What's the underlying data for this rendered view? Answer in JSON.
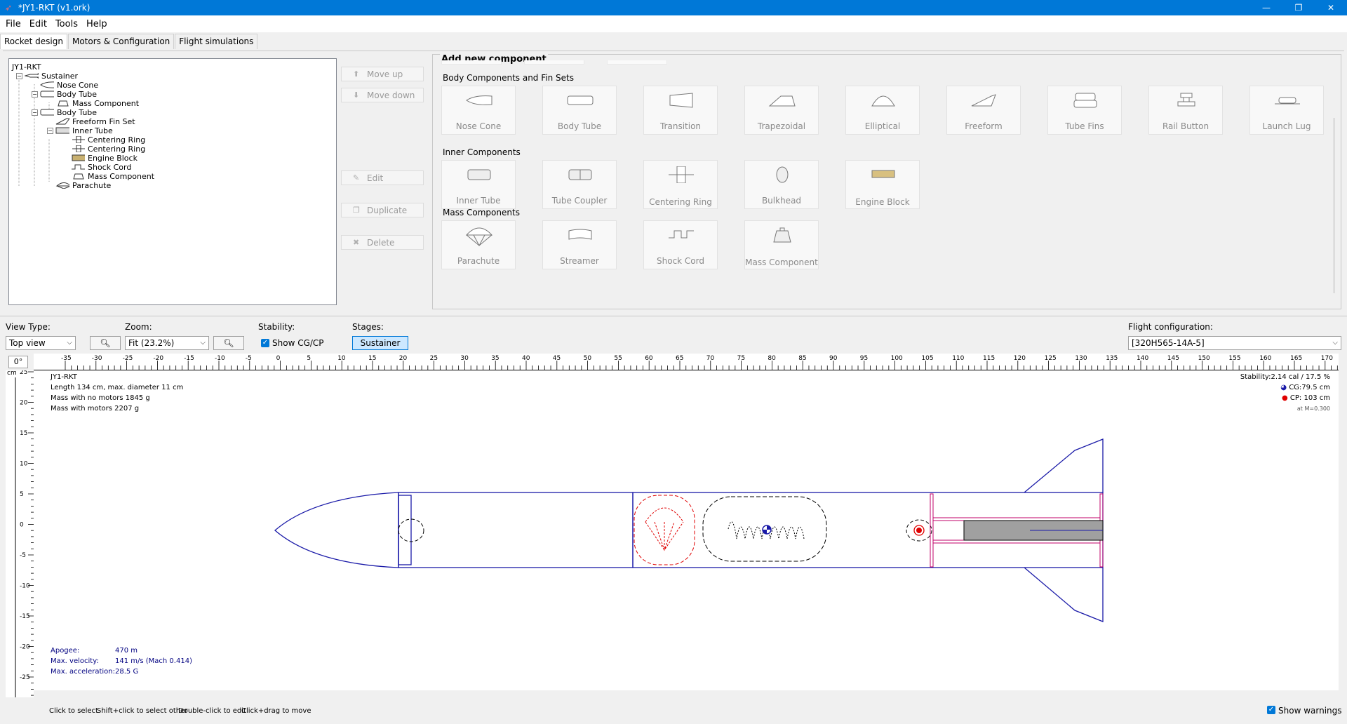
{
  "window": {
    "title": "*JY1-RKT (v1.ork)"
  },
  "menu": [
    "File",
    "Edit",
    "Tools",
    "Help"
  ],
  "tabs": [
    "Rocket design",
    "Motors & Configuration",
    "Flight simulations"
  ],
  "tree": {
    "root": "JY1-RKT",
    "items": [
      "Sustainer",
      "Nose Cone",
      "Body Tube",
      "Mass Component",
      "Body Tube",
      "Freeform Fin Set",
      "Inner Tube",
      "Centering Ring",
      "Centering Ring",
      "Engine Block",
      "Shock Cord",
      "Mass Component",
      "Parachute"
    ]
  },
  "side_buttons": {
    "move_up": "Move up",
    "move_down": "Move down",
    "edit": "Edit",
    "duplicate": "Duplicate",
    "delete": "Delete"
  },
  "add_component": {
    "title": "Add new component",
    "body_section": "Body Components and Fin Sets",
    "body": [
      "Nose Cone",
      "Body Tube",
      "Transition",
      "Trapezoidal",
      "Elliptical",
      "Freeform",
      "Tube Fins",
      "Rail Button",
      "Launch Lug"
    ],
    "inner_section": "Inner Components",
    "inner": [
      "Inner Tube",
      "Tube Coupler",
      "Centering Ring",
      "Bulkhead",
      "Engine Block"
    ],
    "mass_section": "Mass Components",
    "mass": [
      "Parachute",
      "Streamer",
      "Shock Cord",
      "Mass Component"
    ]
  },
  "view": {
    "view_type_label": "View Type:",
    "view_type": "Top view",
    "zoom_label": "Zoom:",
    "zoom": "Fit (23.2%)",
    "stability_label": "Stability:",
    "show_cgcp": "Show CG/CP",
    "stages_label": "Stages:",
    "stage": "Sustainer",
    "flight_config_label": "Flight configuration:",
    "flight_config": "[320H565-14A-5]"
  },
  "ruler": {
    "rotation": "0°",
    "unit": "cm",
    "top_labels": [
      "-35",
      "-30",
      "-25",
      "-20",
      "-15",
      "-10",
      "-5",
      "0",
      "5",
      "10",
      "15",
      "20",
      "25",
      "30",
      "35",
      "40",
      "45",
      "50",
      "55",
      "60",
      "65",
      "70",
      "75",
      "80",
      "85",
      "90",
      "95",
      "100",
      "105",
      "110",
      "115",
      "120",
      "125",
      "130",
      "135",
      "140",
      "145",
      "150",
      "155",
      "160",
      "165",
      "170"
    ],
    "left_labels": [
      "25",
      "20",
      "15",
      "10",
      "5",
      "0",
      "-5",
      "-10",
      "-15",
      "-20",
      "-25"
    ]
  },
  "figure_info": {
    "name": "JY1-RKT",
    "length": "Length 134 cm, max. diameter 11 cm",
    "mass_no_motors": "Mass with no motors 1845 g",
    "mass_with_motors": "Mass with motors 2207 g",
    "stability": "Stability:2.14 cal / 17.5 %",
    "cg": "CG:79.5 cm",
    "cp": "CP: 103 cm",
    "mach": "at M=0.300"
  },
  "flight_info": {
    "apogee_label": "Apogee:",
    "apogee": "470 m",
    "velocity_label": "Max. velocity:",
    "velocity": "141 m/s  (Mach 0.414)",
    "accel_label": "Max. acceleration:",
    "accel": "28.5 G"
  },
  "status": {
    "hints": [
      "Click to select",
      "Shift+click to select other",
      "Double-click to edit",
      "Click+drag to move"
    ],
    "show_warnings": "Show warnings"
  }
}
